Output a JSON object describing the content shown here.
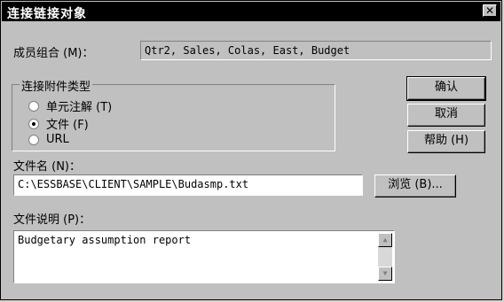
{
  "window": {
    "title": "连接链接对象",
    "close_glyph": "✕"
  },
  "member": {
    "label": "成员组合 (M)：",
    "value": "Qtr2, Sales, Colas, East, Budget"
  },
  "attachment_type": {
    "legend": "连接附件类型",
    "options": [
      {
        "label": "单元注解 (T)",
        "checked": false
      },
      {
        "label": "文件 (F)",
        "checked": true
      },
      {
        "label": "URL",
        "checked": false
      }
    ]
  },
  "buttons": {
    "ok": "确认",
    "cancel": "取消",
    "help": "帮助 (H)",
    "browse": "浏览 (B)..."
  },
  "file_name": {
    "label": "文件名 (N)：",
    "value": "C:\\ESSBASE\\CLIENT\\SAMPLE\\Budasmp.txt"
  },
  "file_description": {
    "label": "文件说明 (P)：",
    "value": "Budgetary assumption report"
  },
  "icons": {
    "scroll_up": "▲",
    "scroll_down": "▼"
  }
}
